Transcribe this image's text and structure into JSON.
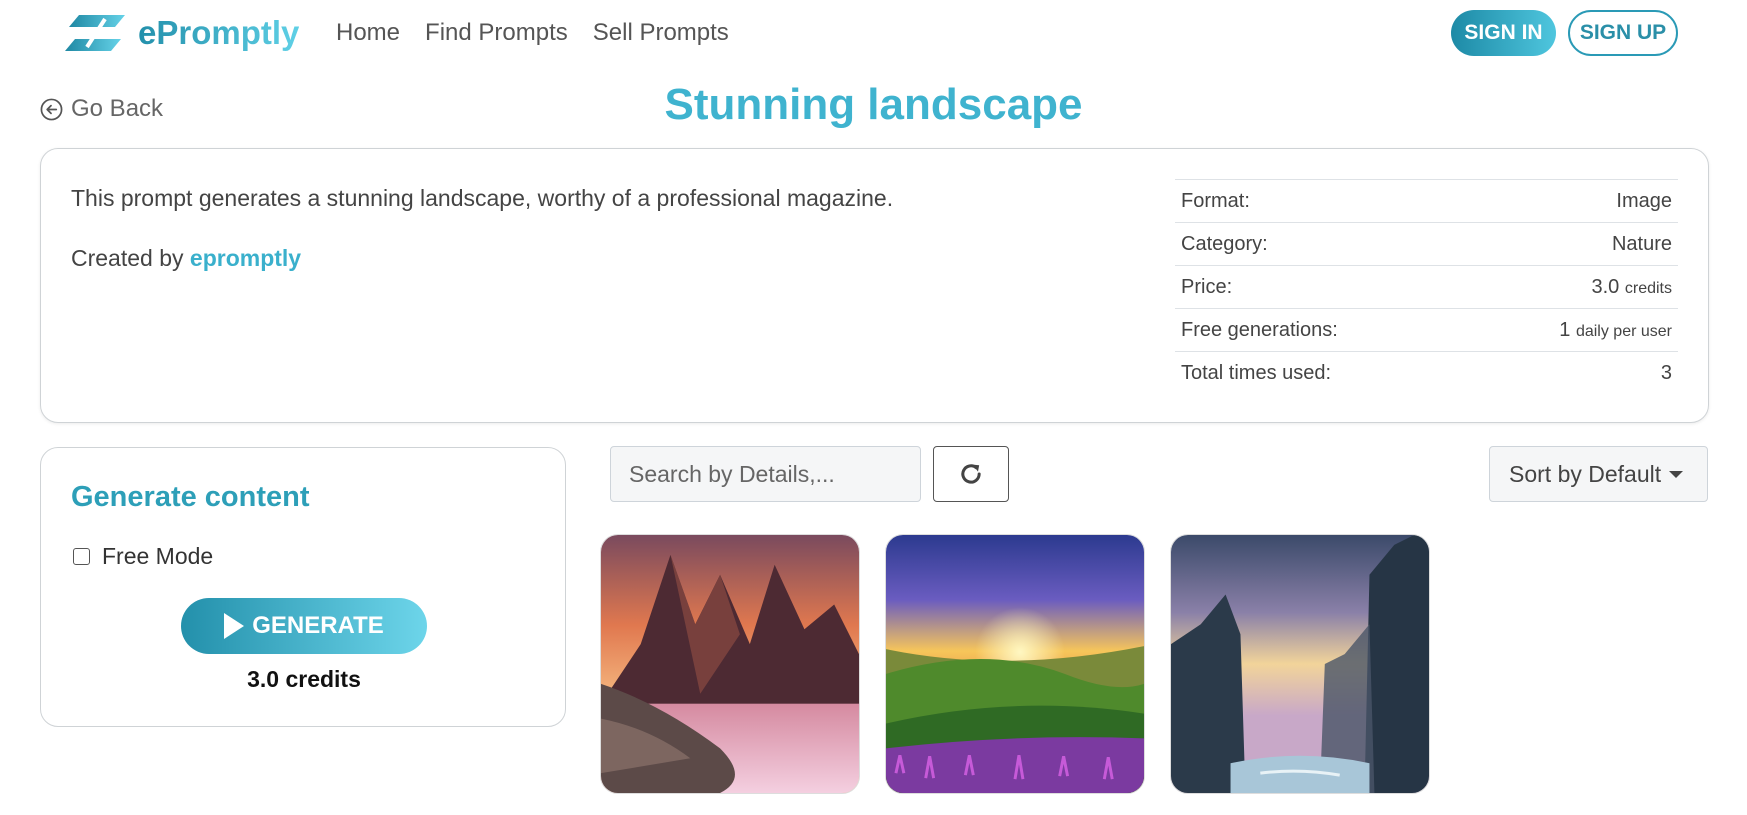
{
  "brand": {
    "name": "ePromptly"
  },
  "nav": {
    "links": [
      "Home",
      "Find Prompts",
      "Sell Prompts"
    ]
  },
  "auth": {
    "signin": "SIGN IN",
    "signup": "SIGN UP"
  },
  "go_back": "Go Back",
  "title": "Stunning landscape",
  "info": {
    "description": "This prompt generates a stunning landscape, worthy of a professional magazine.",
    "created_prefix": "Created by",
    "creator": "epromptly",
    "specs": [
      {
        "label": "Format:",
        "value": "Image",
        "unit": ""
      },
      {
        "label": "Category:",
        "value": "Nature",
        "unit": ""
      },
      {
        "label": "Price:",
        "value": "3.0",
        "unit": "credits"
      },
      {
        "label": "Free generations:",
        "value": "1",
        "unit": "daily per user"
      },
      {
        "label": "Total times used:",
        "value": "3",
        "unit": ""
      }
    ]
  },
  "generate": {
    "title": "Generate content",
    "free_mode_label": "Free Mode",
    "free_mode_checked": false,
    "button_label": "GENERATE",
    "cost": "3.0 credits"
  },
  "toolbar": {
    "search_placeholder": "Search by Details,...",
    "sort_label": "Sort by Default"
  },
  "gallery": [
    {
      "subject": "mountain-sunset-lake"
    },
    {
      "subject": "green-hills-flowers-sunset"
    },
    {
      "subject": "rock-cliffs-dusk"
    }
  ],
  "colors": {
    "accent": "#3fb3cf",
    "brand_dark": "#2390ab"
  }
}
